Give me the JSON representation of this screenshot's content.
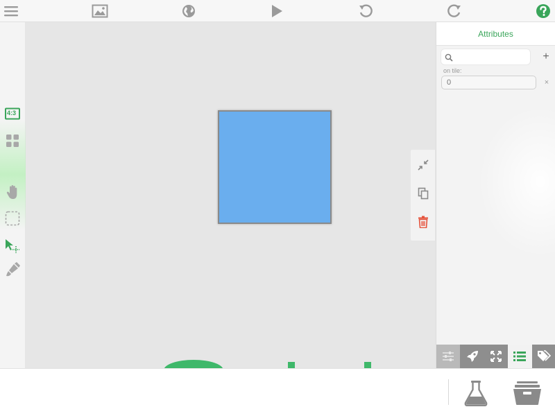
{
  "toolbar": {
    "items": [
      {
        "name": "menu",
        "icon": "hamburger-menu-icon"
      },
      {
        "name": "background",
        "icon": "image-icon"
      },
      {
        "name": "globe",
        "icon": "globe-icon"
      },
      {
        "name": "play",
        "icon": "play-icon"
      },
      {
        "name": "undo",
        "icon": "undo-icon"
      },
      {
        "name": "redo",
        "icon": "redo-icon"
      },
      {
        "name": "help",
        "icon": "help-icon"
      }
    ]
  },
  "left_tools": {
    "aspect_label": "4:3",
    "items": [
      "aspect-ratio-icon",
      "grid-icon",
      "hand-icon",
      "select-rect-icon",
      "pointer-icon",
      "brush-icon"
    ]
  },
  "canvas": {
    "shape_color": "#6aaeee",
    "background": "#e6e6e6"
  },
  "float_actions": [
    "collapse-icon",
    "duplicate-icon",
    "trash-icon"
  ],
  "inspector": {
    "title": "Attributes",
    "search_placeholder": "",
    "add_label": "+",
    "field_label": "on tile:",
    "field_value": "0",
    "clear_label": "×",
    "tabs": [
      "sliders-icon",
      "rocket-icon",
      "expand-icon",
      "list-icon",
      "tag-icon"
    ],
    "active_tab": "list-icon"
  },
  "bottom": {
    "items": [
      "flask-icon",
      "archive-box-icon"
    ]
  },
  "colors": {
    "accent": "#3aa55a",
    "danger": "#e5533c",
    "icon_gray": "#9a9a9a"
  }
}
